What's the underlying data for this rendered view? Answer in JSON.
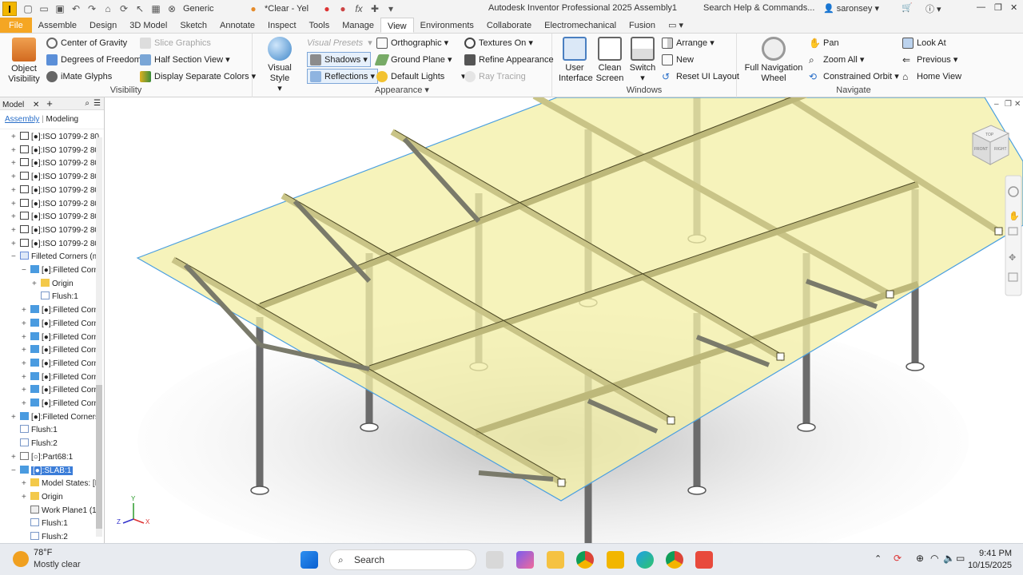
{
  "titlebar": {
    "app_badge": "I",
    "appearance_field": "Generic",
    "color_field": "*Clear - Yel",
    "title": "Autodesk Inventor Professional 2025    Assembly1",
    "search_placeholder": "Search Help & Commands...",
    "user": "saronsey"
  },
  "tabs": [
    "File",
    "Assemble",
    "Design",
    "3D Model",
    "Sketch",
    "Annotate",
    "Inspect",
    "Tools",
    "Manage",
    "View",
    "Environments",
    "Collaborate",
    "Electromechanical",
    "Fusion"
  ],
  "active_tab": "View",
  "ribbon": {
    "visibility": {
      "title": "Visibility",
      "object_visibility": "Object\nVisibility",
      "center_of_gravity": "Center of Gravity",
      "degrees_of_freedom": "Degrees of Freedom",
      "imate_glyphs": "iMate Glyphs",
      "slice_graphics": "Slice Graphics",
      "half_section_view": "Half Section View",
      "display_separate_colors": "Display Separate Colors"
    },
    "appearance": {
      "title": "Appearance",
      "visual_style": "Visual Style",
      "visual_presets": "Visual Presets",
      "shadows": "Shadows",
      "reflections": "Reflections",
      "orthographic": "Orthographic",
      "ground_plane": "Ground Plane",
      "default_lights": "Default Lights",
      "textures_on": "Textures On",
      "refine_appearance": "Refine Appearance",
      "ray_tracing": "Ray Tracing"
    },
    "windows": {
      "title": "Windows",
      "user_interface": "User\nInterface",
      "clean_screen": "Clean\nScreen",
      "switch": "Switch",
      "arrange": "Arrange",
      "new": "New",
      "reset_ui_layout": "Reset UI Layout"
    },
    "navigate": {
      "title": "Navigate",
      "full_navigation_wheel": "Full Navigation\nWheel",
      "pan": "Pan",
      "zoom_all": "Zoom All",
      "constrained_orbit": "Constrained Orbit",
      "look_at": "Look At",
      "previous": "Previous",
      "home_view": "Home View"
    }
  },
  "browser": {
    "header": "Model",
    "tab_assembly": "Assembly",
    "tab_modeling": "Modeling",
    "rows": [
      {
        "label": "[●]:ISO 10799-2 80",
        "exp": "+",
        "indent": 0,
        "icon": "beam"
      },
      {
        "label": "[●]:ISO 10799-2 80",
        "exp": "+",
        "indent": 0,
        "icon": "beam"
      },
      {
        "label": "[●]:ISO 10799-2 80",
        "exp": "+",
        "indent": 0,
        "icon": "beam"
      },
      {
        "label": "[●]:ISO 10799-2 80",
        "exp": "+",
        "indent": 0,
        "icon": "beam"
      },
      {
        "label": "[●]:ISO 10799-2 80",
        "exp": "+",
        "indent": 0,
        "icon": "beam"
      },
      {
        "label": "[●]:ISO 10799-2 80",
        "exp": "+",
        "indent": 0,
        "icon": "beam"
      },
      {
        "label": "[●]:ISO 10799-2 80",
        "exp": "+",
        "indent": 0,
        "icon": "beam"
      },
      {
        "label": "[●]:ISO 10799-2 80",
        "exp": "+",
        "indent": 0,
        "icon": "beam"
      },
      {
        "label": "[●]:ISO 10799-2 80",
        "exp": "+",
        "indent": 0,
        "icon": "beam"
      },
      {
        "label": "Filleted Corners (m",
        "exp": "−",
        "indent": 0,
        "icon": "asm"
      },
      {
        "label": "[●]:Filleted Corn",
        "exp": "−",
        "indent": 1,
        "icon": "part"
      },
      {
        "label": "Origin",
        "exp": "+",
        "indent": 2,
        "icon": "folder"
      },
      {
        "label": "Flush:1",
        "exp": "",
        "indent": 2,
        "icon": "flush"
      },
      {
        "label": "[●]:Filleted Corn",
        "exp": "+",
        "indent": 1,
        "icon": "part"
      },
      {
        "label": "[●]:Filleted Corn",
        "exp": "+",
        "indent": 1,
        "icon": "part"
      },
      {
        "label": "[●]:Filleted Corn",
        "exp": "+",
        "indent": 1,
        "icon": "part"
      },
      {
        "label": "[●]:Filleted Corn",
        "exp": "+",
        "indent": 1,
        "icon": "part"
      },
      {
        "label": "[●]:Filleted Corn",
        "exp": "+",
        "indent": 1,
        "icon": "part"
      },
      {
        "label": "[●]:Filleted Corn",
        "exp": "+",
        "indent": 1,
        "icon": "part"
      },
      {
        "label": "[●]:Filleted Corn",
        "exp": "+",
        "indent": 1,
        "icon": "part"
      },
      {
        "label": "[●]:Filleted Corn",
        "exp": "+",
        "indent": 1,
        "icon": "part"
      },
      {
        "label": "[●]:Filleted Corners",
        "exp": "+",
        "indent": 0,
        "icon": "part"
      },
      {
        "label": "Flush:1",
        "exp": "",
        "indent": 0,
        "icon": "flush"
      },
      {
        "label": "Flush:2",
        "exp": "",
        "indent": 0,
        "icon": "flush"
      },
      {
        "label": "[○]:Part68:1",
        "exp": "+",
        "indent": 0,
        "icon": "partwire"
      },
      {
        "label": "[●]:SLAB:1",
        "exp": "−",
        "indent": 0,
        "icon": "part",
        "selected": true
      },
      {
        "label": "Model States: [Prim",
        "exp": "+",
        "indent": 1,
        "icon": "folder"
      },
      {
        "label": "Origin",
        "exp": "+",
        "indent": 1,
        "icon": "folder"
      },
      {
        "label": "Work Plane1 (1",
        "exp": "",
        "indent": 1,
        "icon": "plane"
      },
      {
        "label": "Flush:1",
        "exp": "",
        "indent": 1,
        "icon": "flush"
      },
      {
        "label": "Flush:2",
        "exp": "",
        "indent": 1,
        "icon": "flush"
      }
    ]
  },
  "viewcube": {
    "top": "TOP",
    "front": "FRONT",
    "right": "RIGHT"
  },
  "triad": {
    "x": "X",
    "y": "Y",
    "z": "Z"
  },
  "taskbar": {
    "temperature": "78°F",
    "weather": "Mostly clear",
    "search": "Search",
    "time": "9:41 PM",
    "date": "10/15/2025"
  },
  "colors": {
    "accent_file": "#f5a623",
    "slab": "#f4efa8",
    "beam": "#c9c487",
    "leg": "#6b6b6b"
  }
}
